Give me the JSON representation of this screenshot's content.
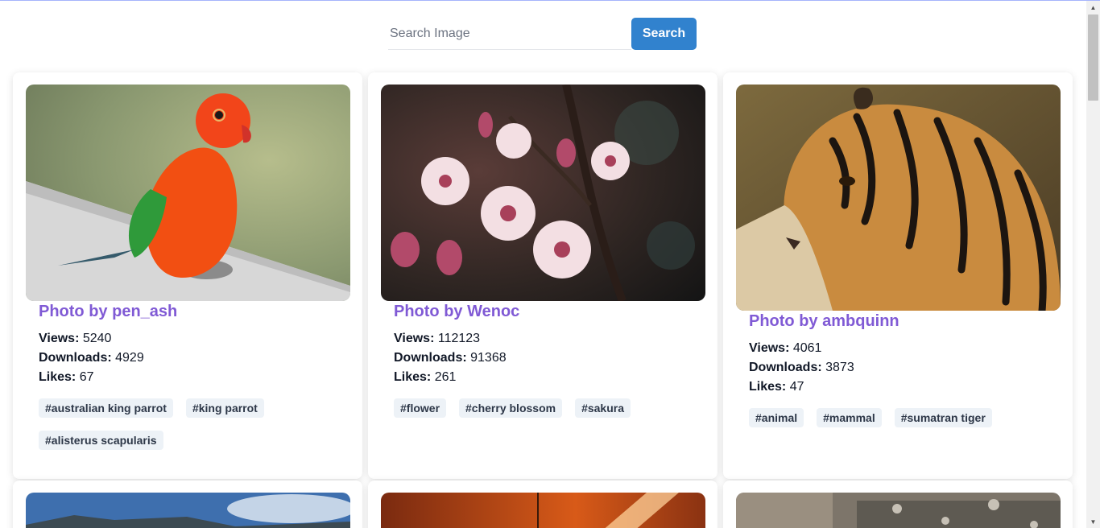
{
  "search": {
    "placeholder": "Search Image",
    "value": "",
    "button_label": "Search"
  },
  "cards": [
    {
      "title": "Photo by pen_ash",
      "views_label": "Views:",
      "views": "5240",
      "downloads_label": "Downloads:",
      "downloads": "4929",
      "likes_label": "Likes:",
      "likes": "67",
      "tags": [
        "#australian king parrot",
        "#king parrot",
        "#alisterus scapularis"
      ],
      "image_subject": "parrot"
    },
    {
      "title": "Photo by Wenoc",
      "views_label": "Views:",
      "views": "112123",
      "downloads_label": "Downloads:",
      "downloads": "91368",
      "likes_label": "Likes:",
      "likes": "261",
      "tags": [
        "#flower",
        "#cherry blossom",
        "#sakura"
      ],
      "image_subject": "cherry-blossom"
    },
    {
      "title": "Photo by ambquinn",
      "views_label": "Views:",
      "views": "4061",
      "downloads_label": "Downloads:",
      "downloads": "3873",
      "likes_label": "Likes:",
      "likes": "47",
      "tags": [
        "#animal",
        "#mammal",
        "#sumatran tiger"
      ],
      "image_subject": "tiger"
    }
  ],
  "partial_cards": [
    {
      "image_subject": "landscape-sky"
    },
    {
      "image_subject": "sunset-glow"
    },
    {
      "image_subject": "rocky-cliff"
    }
  ],
  "colors": {
    "accent": "#3182ce",
    "title": "#805ad5",
    "tag_bg": "#edf2f7"
  }
}
